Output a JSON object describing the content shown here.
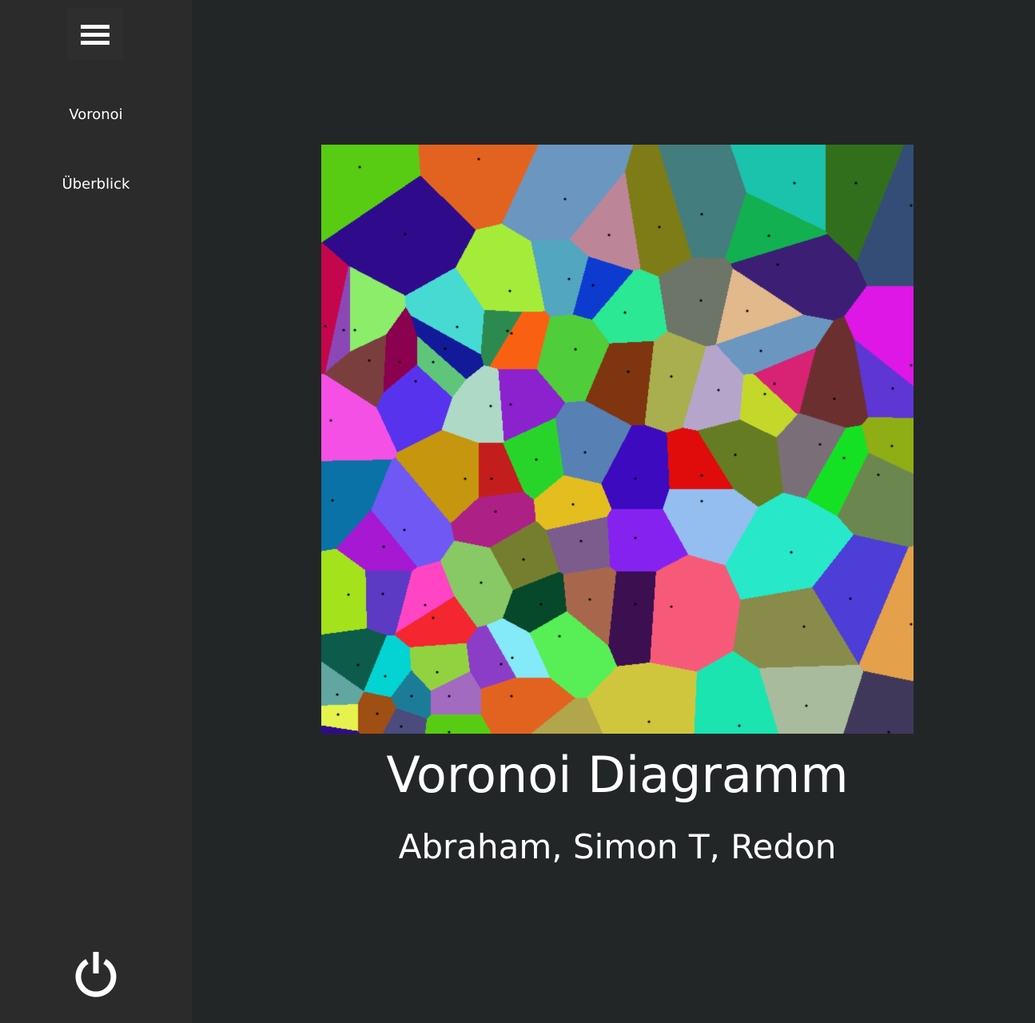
{
  "sidebar": {
    "menu_icon": "hamburger-menu-icon",
    "items": [
      {
        "label": "Voronoi"
      },
      {
        "label": "Überblick"
      }
    ],
    "power_icon": "power-icon"
  },
  "main": {
    "title": "Voronoi Diagramm",
    "subtitle": "Abraham, Simon T, Redon"
  },
  "diagram": {
    "palette": [
      "#2f0b8c",
      "#58cc12",
      "#e26320",
      "#6b96c0",
      "#bc8698",
      "#7d7c17",
      "#437d7d",
      "#1bc2ac",
      "#12b050",
      "#a5eb3a",
      "#2c8a50",
      "#8c47b6",
      "#52a6c0",
      "#0d3bd0",
      "#2be894",
      "#6d7468",
      "#e1b98b",
      "#3c1f74",
      "#326f1c",
      "#334d76",
      "#4fcd3a",
      "#fa6012",
      "#46dad3",
      "#8b004f",
      "#8ced6a",
      "#5fc57a",
      "#7f3510",
      "#b5a5ca",
      "#a9ae4f",
      "#c3d82a",
      "#6c2f2f",
      "#d82274",
      "#5e36d4",
      "#5833ee",
      "#131a99",
      "#8b22ce",
      "#aed9c7",
      "#5780b4",
      "#28d42a",
      "#e00b0b",
      "#7a6f78",
      "#6c8650",
      "#de16e6",
      "#c4064c",
      "#7b3e3e",
      "#f550e6",
      "#0a72a6",
      "#7058f4",
      "#c6960e",
      "#c41d1d",
      "#e3be1e",
      "#3d0ac0",
      "#8622f0",
      "#94beef",
      "#667c22",
      "#27e8c9",
      "#14e124",
      "#8fad14",
      "#a4e21c",
      "#a618d2",
      "#5c3ac4",
      "#ff45c4",
      "#f4262f",
      "#88c865",
      "#ad2186",
      "#757e2f",
      "#05482a",
      "#58ee56",
      "#7b5c8c",
      "#a8674c",
      "#f75a79",
      "#3b0f50",
      "#888b4a",
      "#4c3ed6",
      "#e4a04a",
      "#0c5b4b",
      "#03d3d3",
      "#1c7c98",
      "#92d241",
      "#a26bc0",
      "#8b3dc7",
      "#84e9f9",
      "#b1a64b",
      "#d0c63e",
      "#1be4b0",
      "#a8bc9d",
      "#40385a",
      "#e5f34c",
      "#9f4e14",
      "#4b4b7d",
      "#62a6a2"
    ]
  }
}
